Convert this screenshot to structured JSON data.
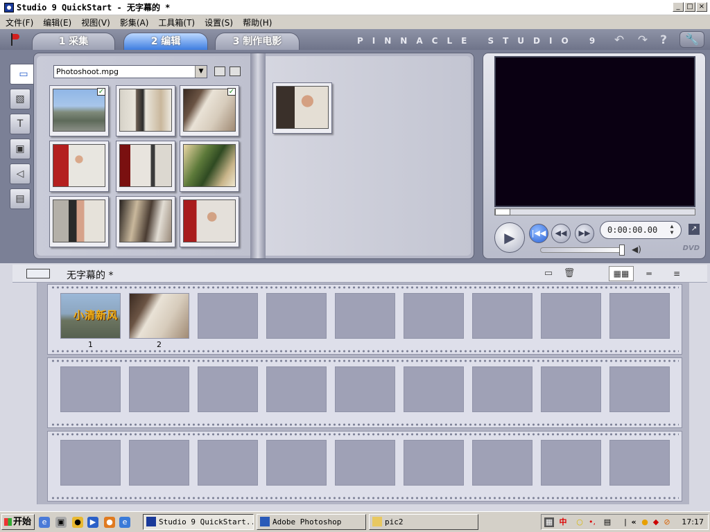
{
  "window": {
    "title": "Studio 9 QuickStart - 无字幕的 *",
    "min_label": "_",
    "max_label": "□",
    "close_label": "×"
  },
  "menu": [
    "文件(F)",
    "编辑(E)",
    "视图(V)",
    "影集(A)",
    "工具箱(T)",
    "设置(S)",
    "帮助(H)"
  ],
  "tabs": [
    {
      "label": "1 采集",
      "active": false
    },
    {
      "label": "2 编辑",
      "active": true
    },
    {
      "label": "3 制作电影",
      "active": false
    }
  ],
  "brand": "PINNACLE STUDIO 9",
  "toolbar_icons": [
    "undo-icon",
    "redo-icon",
    "help-icon",
    "wrench-icon"
  ],
  "album": {
    "file_selected": "Photoshoot.mpg",
    "side_tools": [
      "video-scenes-icon",
      "transitions-icon",
      "titles-icon",
      "still-images-icon",
      "sound-effects-icon",
      "menus-icon"
    ],
    "thumbnails": [
      {
        "scene": "city",
        "checked": true
      },
      {
        "scene": "office",
        "checked": false
      },
      {
        "scene": "stairs",
        "checked": true
      },
      {
        "scene": "woman-red",
        "checked": false
      },
      {
        "scene": "studio",
        "checked": false
      },
      {
        "scene": "plants",
        "checked": false
      },
      {
        "scene": "studio2",
        "checked": false
      },
      {
        "scene": "ladder",
        "checked": false
      },
      {
        "scene": "white",
        "checked": false
      }
    ],
    "right_page_thumbnail": "arms"
  },
  "player": {
    "timecode": "0:00:00.00",
    "buttons": [
      "play-icon",
      "go-to-start-icon",
      "rewind-icon",
      "fast-forward-icon"
    ],
    "dvd_label": "DVD"
  },
  "storyboard": {
    "title": "无字幕的 *",
    "clips": [
      {
        "number": "1",
        "scene": "title",
        "overlay_text": "小清新风"
      },
      {
        "number": "2",
        "scene": "stairs"
      }
    ],
    "rows": 3,
    "cells_per_row": 9
  },
  "taskbar": {
    "start_label": "开始",
    "tasks": [
      {
        "label": "Studio 9 QuickStart...",
        "active": true
      },
      {
        "label": "Adobe Photoshop",
        "active": false
      },
      {
        "label": "pic2",
        "active": false
      }
    ],
    "ime_label": "中",
    "clock": "17:17"
  }
}
